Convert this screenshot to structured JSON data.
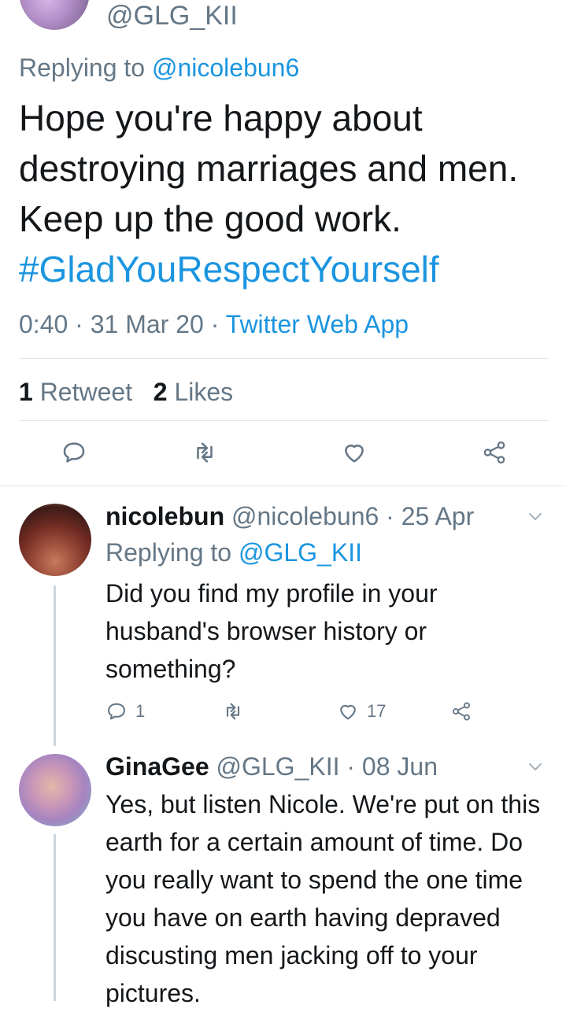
{
  "main_tweet": {
    "handle": "@GLG_KII",
    "replying_prefix": "Replying to ",
    "replying_to": "@nicolebun6",
    "text": "Hope you're happy about destroying marriages and men. Keep up the good work.",
    "hashtag": "#GladYouRespectYourself",
    "time": "0:40",
    "date": "31 Mar 20",
    "source": "Twitter Web App",
    "retweet_count": "1",
    "retweet_label": "Retweet",
    "like_count": "2",
    "like_label": "Likes"
  },
  "replies": [
    {
      "name": "nicolebun",
      "handle": "@nicolebun6",
      "date": "25 Apr",
      "replying_prefix": "Replying to ",
      "replying_to": "@GLG_KII",
      "text": "Did you find my profile in your husband's browser history or something?",
      "reply_count": "1",
      "like_count": "17"
    },
    {
      "name": "GinaGee",
      "handle": "@GLG_KII",
      "date": "08 Jun",
      "text": "Yes, but listen Nicole. We're put on this earth for a certain amount of time. Do you really want to spend the one time you have on earth having depraved discusting men jacking off to your pictures."
    }
  ],
  "icons": {
    "reply": "reply-icon",
    "retweet": "retweet-icon",
    "like": "heart-icon",
    "share": "share-icon",
    "more": "chevron-down-icon"
  },
  "colors": {
    "link": "#1b95e0",
    "muted": "#657786",
    "text": "#14171a",
    "divider": "#e1e8ed"
  }
}
